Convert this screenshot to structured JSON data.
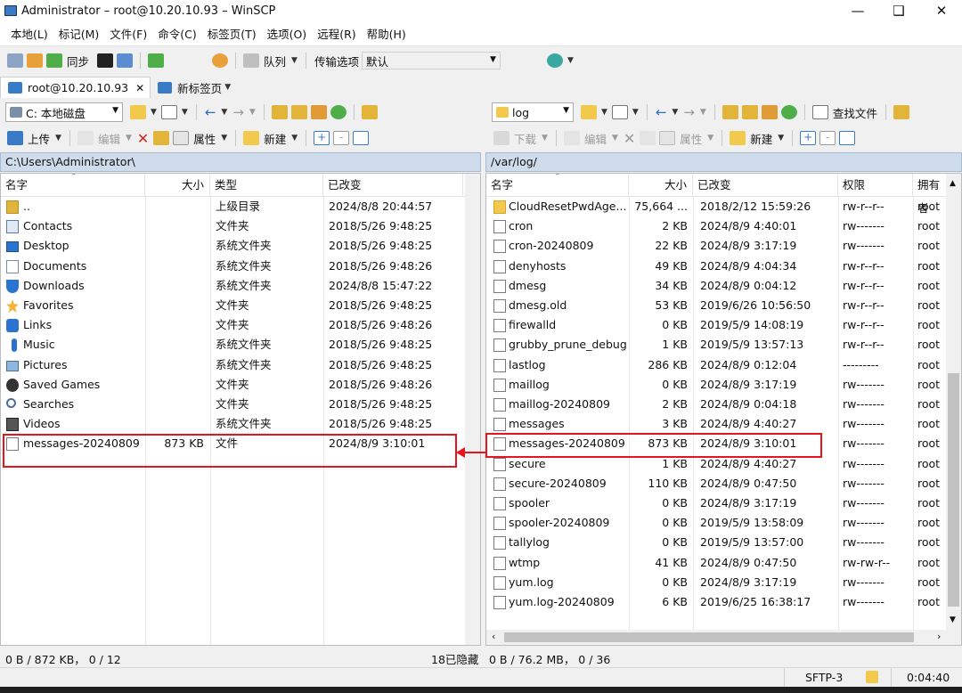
{
  "window": {
    "title": "Administrator – root@10.20.10.93 – WinSCP"
  },
  "menu": [
    "本地(L)",
    "标记(M)",
    "文件(F)",
    "命令(C)",
    "标签页(T)",
    "选项(O)",
    "远程(R)",
    "帮助(H)"
  ],
  "toolbar": {
    "sync_label": "同步",
    "queue_label": "队列",
    "transfer_options_label": "传输选项",
    "transfer_profile": "默认"
  },
  "tabs": {
    "session": "root@10.20.10.93",
    "new_tab": "新标签页"
  },
  "local": {
    "drive": "C: 本地磁盘",
    "upload_label": "上传",
    "edit_label": "编辑",
    "properties_label": "属性",
    "new_label": "新建",
    "path": "C:\\Users\\Administrator\\",
    "columns": [
      "名字",
      "大小",
      "类型",
      "已改变"
    ],
    "files": [
      {
        "name": "..",
        "size": "",
        "type": "上级目录",
        "changed": "2024/8/8 20:44:57",
        "icon": "up-dir-icon"
      },
      {
        "name": "Contacts",
        "size": "",
        "type": "文件夹",
        "changed": "2018/5/26 9:48:25",
        "icon": "contacts-icon"
      },
      {
        "name": "Desktop",
        "size": "",
        "type": "系统文件夹",
        "changed": "2018/5/26 9:48:25",
        "icon": "desktop-icon"
      },
      {
        "name": "Documents",
        "size": "",
        "type": "系统文件夹",
        "changed": "2018/5/26 9:48:26",
        "icon": "documents-icon"
      },
      {
        "name": "Downloads",
        "size": "",
        "type": "系统文件夹",
        "changed": "2024/8/8 15:47:22",
        "icon": "downloads-icon"
      },
      {
        "name": "Favorites",
        "size": "",
        "type": "文件夹",
        "changed": "2018/5/26 9:48:25",
        "icon": "favorites-icon"
      },
      {
        "name": "Links",
        "size": "",
        "type": "文件夹",
        "changed": "2018/5/26 9:48:26",
        "icon": "links-icon"
      },
      {
        "name": "Music",
        "size": "",
        "type": "系统文件夹",
        "changed": "2018/5/26 9:48:25",
        "icon": "music-icon"
      },
      {
        "name": "Pictures",
        "size": "",
        "type": "系统文件夹",
        "changed": "2018/5/26 9:48:25",
        "icon": "pictures-icon"
      },
      {
        "name": "Saved Games",
        "size": "",
        "type": "文件夹",
        "changed": "2018/5/26 9:48:26",
        "icon": "saved-games-icon"
      },
      {
        "name": "Searches",
        "size": "",
        "type": "文件夹",
        "changed": "2018/5/26 9:48:25",
        "icon": "searches-icon"
      },
      {
        "name": "Videos",
        "size": "",
        "type": "系统文件夹",
        "changed": "2018/5/26 9:48:25",
        "icon": "videos-icon"
      },
      {
        "name": "messages-20240809",
        "size": "873 KB",
        "type": "文件",
        "changed": "2024/8/9 3:10:01",
        "icon": "file-icon"
      }
    ],
    "status": "0 B / 872 KB， 0 / 12",
    "hidden": "18已隐藏"
  },
  "remote": {
    "dir": "log",
    "download_label": "下载",
    "edit_label": "编辑",
    "properties_label": "属性",
    "new_label": "新建",
    "find_label": "查找文件",
    "path": "/var/log/",
    "columns": [
      "名字",
      "大小",
      "已改变",
      "权限",
      "拥有者"
    ],
    "files": [
      {
        "name": "CloudResetPwdAge...",
        "size": "75,664 ...",
        "changed": "2018/2/12 15:59:26",
        "rights": "rw-r--r--",
        "owner": "root",
        "icon": "folder-icon"
      },
      {
        "name": "cron",
        "size": "2 KB",
        "changed": "2024/8/9 4:40:01",
        "rights": "rw-------",
        "owner": "root",
        "icon": "file-icon"
      },
      {
        "name": "cron-20240809",
        "size": "22 KB",
        "changed": "2024/8/9 3:17:19",
        "rights": "rw-------",
        "owner": "root",
        "icon": "file-icon"
      },
      {
        "name": "denyhosts",
        "size": "49 KB",
        "changed": "2024/8/9 4:04:34",
        "rights": "rw-r--r--",
        "owner": "root",
        "icon": "file-icon"
      },
      {
        "name": "dmesg",
        "size": "34 KB",
        "changed": "2024/8/9 0:04:12",
        "rights": "rw-r--r--",
        "owner": "root",
        "icon": "file-icon"
      },
      {
        "name": "dmesg.old",
        "size": "53 KB",
        "changed": "2019/6/26 10:56:50",
        "rights": "rw-r--r--",
        "owner": "root",
        "icon": "file-icon"
      },
      {
        "name": "firewalld",
        "size": "0 KB",
        "changed": "2019/5/9 14:08:19",
        "rights": "rw-r--r--",
        "owner": "root",
        "icon": "file-icon"
      },
      {
        "name": "grubby_prune_debug",
        "size": "1 KB",
        "changed": "2019/5/9 13:57:13",
        "rights": "rw-r--r--",
        "owner": "root",
        "icon": "file-icon"
      },
      {
        "name": "lastlog",
        "size": "286 KB",
        "changed": "2024/8/9 0:12:04",
        "rights": "---------",
        "owner": "root",
        "icon": "file-icon"
      },
      {
        "name": "maillog",
        "size": "0 KB",
        "changed": "2024/8/9 3:17:19",
        "rights": "rw-------",
        "owner": "root",
        "icon": "file-icon"
      },
      {
        "name": "maillog-20240809",
        "size": "2 KB",
        "changed": "2024/8/9 0:04:18",
        "rights": "rw-------",
        "owner": "root",
        "icon": "file-icon"
      },
      {
        "name": "messages",
        "size": "3 KB",
        "changed": "2024/8/9 4:40:27",
        "rights": "rw-------",
        "owner": "root",
        "icon": "file-icon"
      },
      {
        "name": "messages-20240809",
        "size": "873 KB",
        "changed": "2024/8/9 3:10:01",
        "rights": "rw-------",
        "owner": "root",
        "icon": "file-icon"
      },
      {
        "name": "secure",
        "size": "1 KB",
        "changed": "2024/8/9 4:40:27",
        "rights": "rw-------",
        "owner": "root",
        "icon": "file-icon"
      },
      {
        "name": "secure-20240809",
        "size": "110 KB",
        "changed": "2024/8/9 0:47:50",
        "rights": "rw-------",
        "owner": "root",
        "icon": "file-icon"
      },
      {
        "name": "spooler",
        "size": "0 KB",
        "changed": "2024/8/9 3:17:19",
        "rights": "rw-------",
        "owner": "root",
        "icon": "file-icon"
      },
      {
        "name": "spooler-20240809",
        "size": "0 KB",
        "changed": "2019/5/9 13:58:09",
        "rights": "rw-------",
        "owner": "root",
        "icon": "file-icon"
      },
      {
        "name": "tallylog",
        "size": "0 KB",
        "changed": "2019/5/9 13:57:00",
        "rights": "rw-------",
        "owner": "root",
        "icon": "file-icon"
      },
      {
        "name": "wtmp",
        "size": "41 KB",
        "changed": "2024/8/9 0:47:50",
        "rights": "rw-rw-r--",
        "owner": "root",
        "icon": "file-icon"
      },
      {
        "name": "yum.log",
        "size": "0 KB",
        "changed": "2024/8/9 3:17:19",
        "rights": "rw-------",
        "owner": "root",
        "icon": "file-icon"
      },
      {
        "name": "yum.log-20240809",
        "size": "6 KB",
        "changed": "2019/6/25 16:38:17",
        "rights": "rw-------",
        "owner": "root",
        "icon": "file-icon"
      }
    ],
    "status": "0 B / 76.2 MB， 0 / 36"
  },
  "status_right": {
    "protocol": "SFTP-3",
    "time": "0:04:40"
  },
  "colors": {
    "highlight": "#e5141d",
    "path_bar": "#cfdcec"
  }
}
